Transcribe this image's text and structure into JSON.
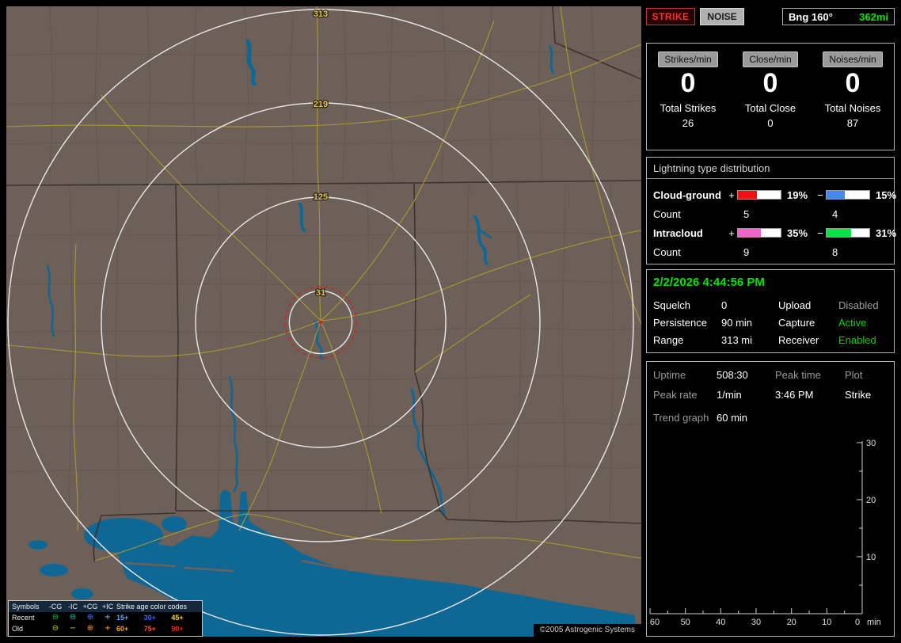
{
  "colors": {
    "accent_green": "#00e400",
    "dim_gray": "#9a9a9a"
  },
  "toolbar": {
    "strike": "STRIKE",
    "noise": "NOISE",
    "bearing": "Bng 160°",
    "distance": "362mi"
  },
  "rates": {
    "columns": [
      {
        "chip": "Strikes/min",
        "value": "0",
        "total_label": "Total Strikes",
        "total_value": "26"
      },
      {
        "chip": "Close/min",
        "value": "0",
        "total_label": "Total Close",
        "total_value": "0"
      },
      {
        "chip": "Noises/min",
        "value": "0",
        "total_label": "Total Noises",
        "total_value": "87"
      }
    ]
  },
  "distribution": {
    "title": "Lightning type distribution",
    "plus_sign": "+",
    "minus_sign": "−",
    "count_label": "Count",
    "rows": [
      {
        "label": "Cloud-ground",
        "plus": {
          "pct": "19%",
          "count": "5",
          "color": "#ee1111",
          "fill": 45
        },
        "minus": {
          "pct": "15%",
          "count": "4",
          "color": "#4488ee",
          "fill": 42
        }
      },
      {
        "label": "Intracloud",
        "plus": {
          "pct": "35%",
          "count": "9",
          "color": "#ee66cc",
          "fill": 54
        },
        "minus": {
          "pct": "31%",
          "count": "8",
          "color": "#11dd44",
          "fill": 57
        }
      }
    ]
  },
  "clock": {
    "datetime": "2/2/2026 4:44:56 PM"
  },
  "settings": [
    {
      "l1": "Squelch",
      "v1": "0",
      "l2": "Upload",
      "v2": "Disabled",
      "v2_color": "#9e9e9e"
    },
    {
      "l1": "Persistence",
      "v1": "90 min",
      "l2": "Capture",
      "v2": "Active",
      "v2_color": "#00d400"
    },
    {
      "l1": "Range",
      "v1": "313 mi",
      "l2": "Receiver",
      "v2": "Enabled",
      "v2_color": "#00d400"
    }
  ],
  "monitor": {
    "uptime_label": "Uptime",
    "uptime_value": "508:30",
    "peak_time_label": "Peak time",
    "plot_label": "Plot",
    "peak_rate_label": "Peak rate",
    "peak_rate_value": "1/min",
    "peak_time_value": "3:46 PM",
    "plot_value": "Strike",
    "trend_label": "Trend graph",
    "trend_value": "60 min"
  },
  "trend_chart": {
    "type": "line",
    "x_unit": "min",
    "x_ticks": [
      "60",
      "50",
      "40",
      "30",
      "20",
      "10",
      "0"
    ],
    "y_ticks": [
      "30",
      "20",
      "10"
    ],
    "x_range": [
      60,
      0
    ],
    "y_range": [
      0,
      30
    ],
    "series": []
  },
  "map": {
    "rings": [
      {
        "label": "313"
      },
      {
        "label": "219"
      },
      {
        "label": "125"
      },
      {
        "label": "31"
      }
    ],
    "copyright": "©2005 Astrogenic Systems",
    "colors": {
      "land": "#6d6058",
      "water": "#0f6795",
      "road": "#b0a02c",
      "ring": "#e9e9e9",
      "ring_label": "#e2c24a",
      "alarm": "#cc2222",
      "state_border": "#3a342f",
      "county_border": "#5e534c"
    },
    "legend": {
      "symbols_header": "Symbols",
      "type_headers": [
        "-CG",
        "-IC",
        "+CG",
        "+IC"
      ],
      "age_header": "Strike age color codes",
      "recent_label": "Recent",
      "old_label": "Old",
      "recent_symbols": [
        {
          "glyph": "⊖",
          "color": "#00cc44"
        },
        {
          "glyph": "⊖",
          "color": "#00cccc"
        },
        {
          "glyph": "⊕",
          "color": "#4477ff"
        },
        {
          "glyph": "+",
          "color": "#9ab8ff"
        }
      ],
      "old_symbols": [
        {
          "glyph": "⊖",
          "color": "#cccc22"
        },
        {
          "glyph": "−",
          "color": "#cccc22"
        },
        {
          "glyph": "⊕",
          "color": "#ff9922"
        },
        {
          "glyph": "+",
          "color": "#ffaa33"
        }
      ],
      "recent_ages": [
        {
          "label": "15+",
          "color": "#55aaff"
        },
        {
          "label": "30+",
          "color": "#3366ff"
        },
        {
          "label": "45+",
          "color": "#ffd633"
        }
      ],
      "old_ages": [
        {
          "label": "60+",
          "color": "#ffaa00"
        },
        {
          "label": "75+",
          "color": "#ff5522"
        },
        {
          "label": "90+",
          "color": "#ff2211"
        }
      ]
    }
  }
}
